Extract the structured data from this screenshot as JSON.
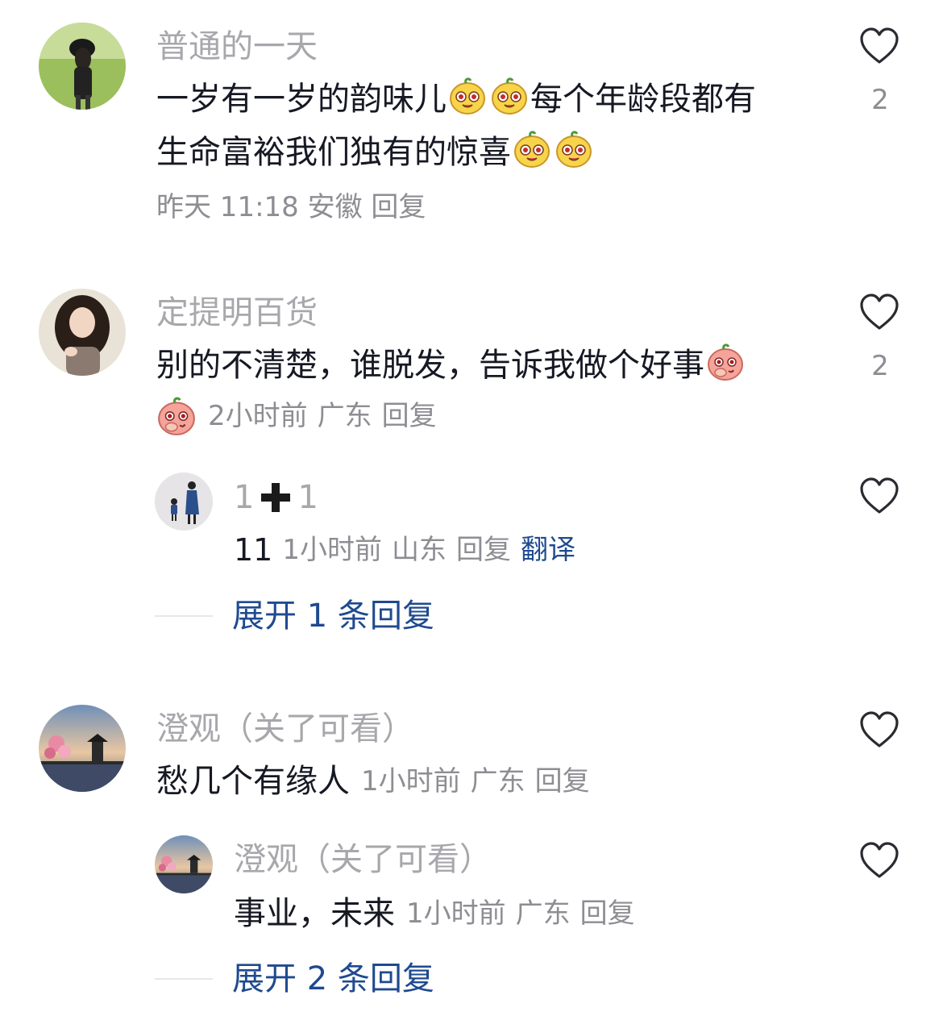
{
  "comments": [
    {
      "username": "普通的一天",
      "text_a": "一岁有一岁的韵味儿",
      "text_b": "每个年龄段都有",
      "text_c": "生命富裕我们独有的惊喜",
      "time": "昨天 11:18",
      "location": "安徽",
      "reply": "回复",
      "likes": "2",
      "emoji_name": "yellow-blob-emoji"
    },
    {
      "username": "定提明百货",
      "text": "别的不清楚，谁脱发，告诉我做个好事",
      "time": "2小时前",
      "location": "广东",
      "reply": "回复",
      "likes": "2",
      "emoji_name": "pink-blushing-emoji",
      "sub": {
        "username_a": "1",
        "username_b": "1",
        "text": "11",
        "time": "1小时前",
        "location": "山东",
        "reply": "回复",
        "translate": "翻译"
      },
      "expand_label": "展开 1 条回复"
    },
    {
      "username": "澄观（关了可看）",
      "text": "愁几个有缘人",
      "time": "1小时前",
      "location": "广东",
      "reply": "回复",
      "sub": {
        "username": "澄观（关了可看）",
        "text": "事业，未来",
        "time": "1小时前",
        "location": "广东",
        "reply": "回复"
      },
      "expand_label": "展开 2 条回复"
    }
  ],
  "colors": {
    "username": "#a7a7ac",
    "text": "#161823",
    "meta": "#8d8d93",
    "link": "#1f4a8f"
  }
}
